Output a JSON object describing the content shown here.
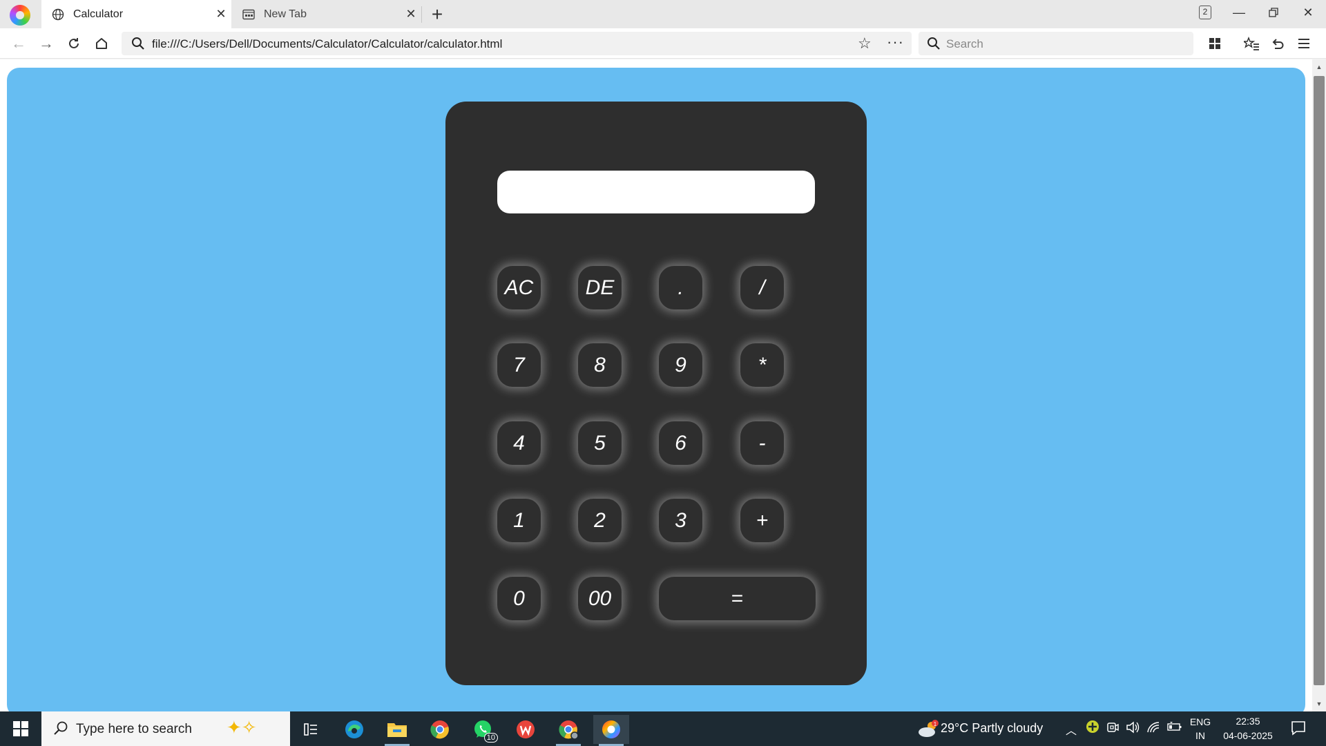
{
  "browser": {
    "tabs": [
      {
        "title": "Calculator",
        "active": true
      },
      {
        "title": "New Tab",
        "active": false
      }
    ],
    "tab_count": "2",
    "url": "file:///C:/Users/Dell/Documents/Calculator/Calculator/calculator.html",
    "search_placeholder": "Search"
  },
  "calculator": {
    "display_value": "",
    "keys": [
      "AC",
      "DE",
      ".",
      "/",
      "7",
      "8",
      "9",
      "*",
      "4",
      "5",
      "6",
      "-",
      "1",
      "2",
      "3",
      "+",
      "0",
      "00",
      "="
    ],
    "colors": {
      "page_background": "#66bdf2",
      "body": "#2e2e2e",
      "display": "#ffffff",
      "key_text": "#ffffff"
    }
  },
  "taskbar": {
    "search_placeholder": "Type here to search",
    "whatsapp_badge": "10",
    "weather_alert": "1",
    "weather": "29°C  Partly cloudy",
    "language_line1": "ENG",
    "language_line2": "IN",
    "time": "22:35",
    "date": "04-06-2025"
  }
}
